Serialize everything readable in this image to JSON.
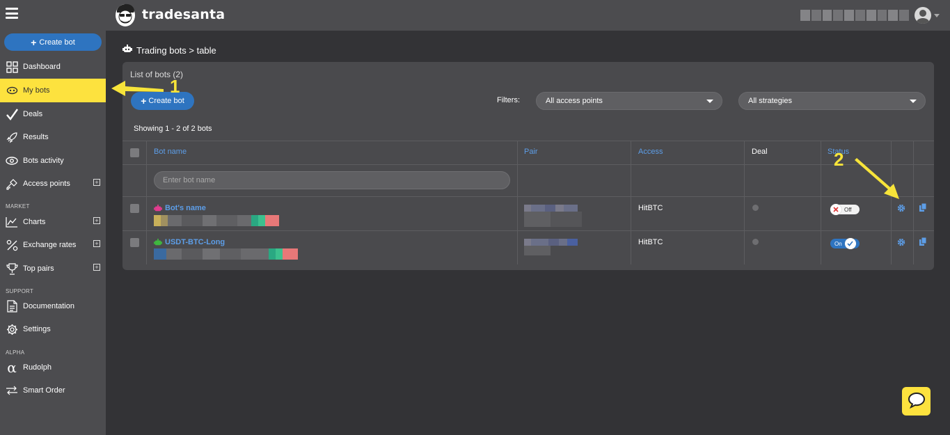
{
  "brand": {
    "name": "tradesanta"
  },
  "sidebar": {
    "create_label": "Create bot",
    "items": [
      {
        "label": "Dashboard",
        "icon": "dashboard-icon"
      },
      {
        "label": "My bots",
        "icon": "bot-icon",
        "active": true
      },
      {
        "label": "Deals",
        "icon": "check-icon"
      },
      {
        "label": "Results",
        "icon": "rocket-icon"
      },
      {
        "label": "Bots activity",
        "icon": "eye-icon"
      },
      {
        "label": "Access points",
        "icon": "key-icon",
        "expandable": true
      }
    ],
    "market_label": "MARKET",
    "market_items": [
      {
        "label": "Charts",
        "icon": "chart-icon",
        "expandable": true
      },
      {
        "label": "Exchange rates",
        "icon": "percent-icon",
        "expandable": true
      },
      {
        "label": "Top pairs",
        "icon": "trophy-icon",
        "expandable": true
      }
    ],
    "support_label": "SUPPORT",
    "support_items": [
      {
        "label": "Documentation",
        "icon": "document-icon"
      },
      {
        "label": "Settings",
        "icon": "gear-icon"
      }
    ],
    "alpha_label": "ALPHA",
    "alpha_items": [
      {
        "label": "Rudolph",
        "icon": "alpha-icon"
      },
      {
        "label": "Smart Order",
        "icon": "arrows-icon"
      }
    ]
  },
  "breadcrumb": {
    "text": "Trading bots > table"
  },
  "card": {
    "title": "List of bots (2)",
    "create_label": "Create bot",
    "filters_label": "Filters:",
    "filter_access": "All access points",
    "filter_strategy": "All strategies",
    "showing": "Showing 1 - 2 of 2 bots"
  },
  "table": {
    "columns": [
      "Bot name",
      "Pair",
      "Access",
      "Deal",
      "Status"
    ],
    "search_placeholder": "Enter bot name",
    "rows": [
      {
        "name": "Bot's name",
        "access": "HitBTC",
        "status": "Off",
        "bot_color": "#e23b8f"
      },
      {
        "name": "USDT-BTC-Long",
        "access": "HitBTC",
        "status": "On",
        "bot_color": "#3fb83f"
      }
    ]
  },
  "annotations": {
    "one": "1",
    "two": "2",
    "color": "#f7e43a"
  },
  "colors": {
    "accent": "#2e74c0",
    "active": "#fde23e",
    "link": "#5d9ee8"
  }
}
